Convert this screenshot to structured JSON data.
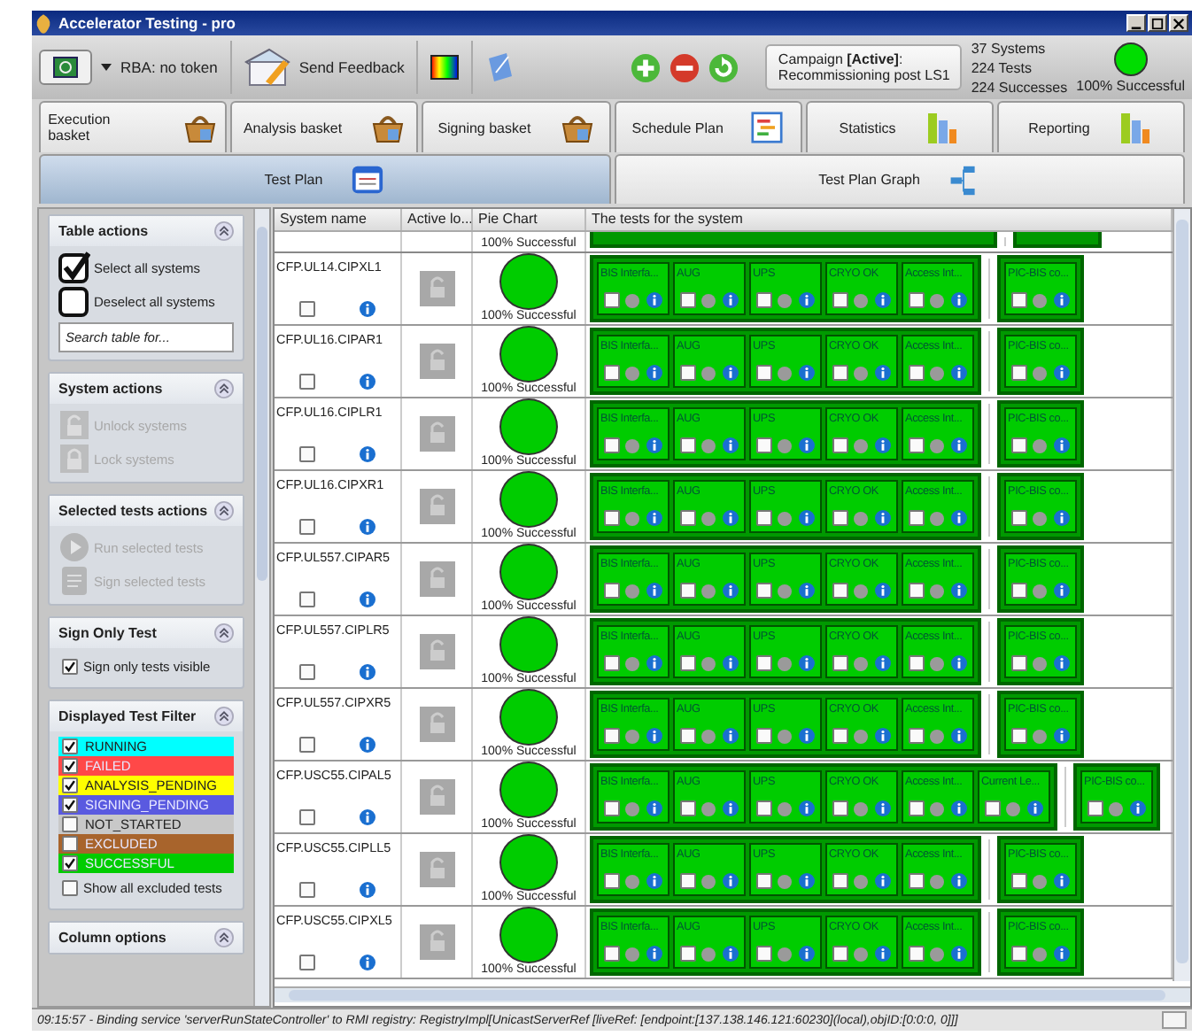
{
  "window": {
    "title": "Accelerator Testing - pro"
  },
  "toolbar": {
    "rba": "RBA: no token",
    "feedback": "Send Feedback",
    "campaign": [
      "Campaign **[Active]**:",
      "Recommissioning post LS1"
    ],
    "summary": [
      "37 Systems",
      "224 Tests",
      "224 Successes"
    ],
    "overall": "100% Successful"
  },
  "tabs": [
    [
      {
        "label": "Execution basket",
        "selected": false
      },
      {
        "label": "Analysis basket",
        "selected": false
      },
      {
        "label": "Signing basket",
        "selected": false
      },
      {
        "label": "Schedule Plan",
        "selected": false
      },
      {
        "label": "Statistics",
        "selected": false
      },
      {
        "label": "Reporting",
        "selected": false
      }
    ],
    [
      {
        "label": "Test Plan",
        "selected": true
      },
      {
        "label": "Test Plan Graph",
        "selected": false
      }
    ]
  ],
  "sidebar": [
    {
      "title": "Table actions",
      "kind": "table",
      "items": [
        {
          "label": "Select all systems"
        },
        {
          "label": "Deselect all systems"
        }
      ],
      "placeholder": "Search table for..."
    },
    {
      "title": "System actions",
      "kind": "actions",
      "items": [
        {
          "label": "Unlock systems",
          "disabled": true
        },
        {
          "label": "Lock systems",
          "disabled": true
        }
      ]
    },
    {
      "title": "Selected tests actions",
      "kind": "actions",
      "items": [
        {
          "label": "Run selected tests",
          "disabled": true
        },
        {
          "label": "Sign selected tests",
          "disabled": true
        }
      ]
    },
    {
      "title": "Sign Only Test",
      "kind": "check",
      "label": "Sign only tests visible",
      "checked": true
    },
    {
      "title": "Displayed Test Filter",
      "kind": "filter",
      "filters": [
        {
          "label": "RUNNING",
          "checked": true,
          "color": "#00ffff"
        },
        {
          "label": "FAILED",
          "checked": true,
          "color": "#ff4848"
        },
        {
          "label": "ANALYSIS_PENDING",
          "checked": true,
          "color": "#ffff00"
        },
        {
          "label": "SIGNING_PENDING",
          "checked": true,
          "color": "#5a5ae0"
        },
        {
          "label": "NOT_STARTED",
          "checked": false,
          "color": "#c8c8c8"
        },
        {
          "label": "EXCLUDED",
          "checked": false,
          "color": "#a8642c"
        },
        {
          "label": "SUCCESSFUL",
          "checked": true,
          "color": "#00cc00"
        }
      ],
      "label": "Show all excluded tests",
      "checked": false
    },
    {
      "title": "Column options",
      "kind": "header"
    }
  ],
  "table": {
    "columns": [
      "System name",
      "Active lo...",
      "Pie Chart",
      "The tests for the system"
    ],
    "partial_row": {
      "pie_label": "100% Successful"
    },
    "rows": [
      {
        "name": "CFP.UL14.CIPXL1",
        "checked": false,
        "pie_label": "100% Successful",
        "tests": [
          {
            "name": "BIS Interfa...",
            "checked": false
          },
          {
            "name": "AUG",
            "checked": false
          },
          {
            "name": "UPS",
            "checked": false
          },
          {
            "name": "CRYO OK",
            "checked": false
          },
          {
            "name": "Access Int...",
            "checked": false
          }
        ],
        "extra_tests": [
          {
            "name": "PIC-BIS co...",
            "checked": false
          }
        ]
      },
      {
        "name": "CFP.UL16.CIPAR1",
        "checked": false,
        "pie_label": "100% Successful",
        "tests": [
          {
            "name": "BIS Interfa...",
            "checked": false
          },
          {
            "name": "AUG",
            "checked": false
          },
          {
            "name": "UPS",
            "checked": false
          },
          {
            "name": "CRYO OK",
            "checked": false
          },
          {
            "name": "Access Int...",
            "checked": false
          }
        ],
        "extra_tests": [
          {
            "name": "PIC-BIS co...",
            "checked": false
          }
        ]
      },
      {
        "name": "CFP.UL16.CIPLR1",
        "checked": false,
        "pie_label": "100% Successful",
        "tests": [
          {
            "name": "BIS Interfa...",
            "checked": false
          },
          {
            "name": "AUG",
            "checked": false
          },
          {
            "name": "UPS",
            "checked": false
          },
          {
            "name": "CRYO OK",
            "checked": false
          },
          {
            "name": "Access Int...",
            "checked": false
          }
        ],
        "extra_tests": [
          {
            "name": "PIC-BIS co...",
            "checked": false
          }
        ]
      },
      {
        "name": "CFP.UL16.CIPXR1",
        "checked": false,
        "pie_label": "100% Successful",
        "tests": [
          {
            "name": "BIS Interfa...",
            "checked": false
          },
          {
            "name": "AUG",
            "checked": false
          },
          {
            "name": "UPS",
            "checked": false
          },
          {
            "name": "CRYO OK",
            "checked": false
          },
          {
            "name": "Access Int...",
            "checked": false
          }
        ],
        "extra_tests": [
          {
            "name": "PIC-BIS co...",
            "checked": false
          }
        ]
      },
      {
        "name": "CFP.UL557.CIPAR5",
        "checked": false,
        "pie_label": "100% Successful",
        "tests": [
          {
            "name": "BIS Interfa...",
            "checked": false
          },
          {
            "name": "AUG",
            "checked": false
          },
          {
            "name": "UPS",
            "checked": false
          },
          {
            "name": "CRYO OK",
            "checked": false
          },
          {
            "name": "Access Int...",
            "checked": false
          }
        ],
        "extra_tests": [
          {
            "name": "PIC-BIS co...",
            "checked": false
          }
        ]
      },
      {
        "name": "CFP.UL557.CIPLR5",
        "checked": false,
        "pie_label": "100% Successful",
        "tests": [
          {
            "name": "BIS Interfa...",
            "checked": false
          },
          {
            "name": "AUG",
            "checked": false
          },
          {
            "name": "UPS",
            "checked": false
          },
          {
            "name": "CRYO OK",
            "checked": false
          },
          {
            "name": "Access Int...",
            "checked": false
          }
        ],
        "extra_tests": [
          {
            "name": "PIC-BIS co...",
            "checked": false
          }
        ]
      },
      {
        "name": "CFP.UL557.CIPXR5",
        "checked": false,
        "pie_label": "100% Successful",
        "tests": [
          {
            "name": "BIS Interfa...",
            "checked": false
          },
          {
            "name": "AUG",
            "checked": false
          },
          {
            "name": "UPS",
            "checked": false
          },
          {
            "name": "CRYO OK",
            "checked": false
          },
          {
            "name": "Access Int...",
            "checked": false
          }
        ],
        "extra_tests": [
          {
            "name": "PIC-BIS co...",
            "checked": false
          }
        ]
      },
      {
        "name": "CFP.USC55.CIPAL5",
        "checked": false,
        "pie_label": "100% Successful",
        "tests": [
          {
            "name": "BIS Interfa...",
            "checked": false
          },
          {
            "name": "AUG",
            "checked": false
          },
          {
            "name": "UPS",
            "checked": false
          },
          {
            "name": "CRYO OK",
            "checked": false
          },
          {
            "name": "Access Int...",
            "checked": false
          },
          {
            "name": "Current Le...",
            "checked": false
          }
        ],
        "extra_tests": [
          {
            "name": "PIC-BIS co...",
            "checked": false
          }
        ]
      },
      {
        "name": "CFP.USC55.CIPLL5",
        "checked": false,
        "pie_label": "100% Successful",
        "tests": [
          {
            "name": "BIS Interfa...",
            "checked": false
          },
          {
            "name": "AUG",
            "checked": false
          },
          {
            "name": "UPS",
            "checked": false
          },
          {
            "name": "CRYO OK",
            "checked": false
          },
          {
            "name": "Access Int...",
            "checked": false
          }
        ],
        "extra_tests": [
          {
            "name": "PIC-BIS co...",
            "checked": false
          }
        ]
      },
      {
        "name": "CFP.USC55.CIPXL5",
        "checked": false,
        "pie_label": "100% Successful",
        "tests": [
          {
            "name": "BIS Interfa...",
            "checked": false
          },
          {
            "name": "AUG",
            "checked": false
          },
          {
            "name": "UPS",
            "checked": false
          },
          {
            "name": "CRYO OK",
            "checked": false
          },
          {
            "name": "Access Int...",
            "checked": false
          }
        ],
        "extra_tests": [
          {
            "name": "PIC-BIS co...",
            "checked": false
          }
        ]
      }
    ]
  },
  "status_bar": "09:15:57 - Binding service 'serverRunStateController' to RMI registry: RegistryImpl[UnicastServerRef [liveRef: [endpoint:[137.138.146.121:60230](local),objID:[0:0:0, 0]]]"
}
